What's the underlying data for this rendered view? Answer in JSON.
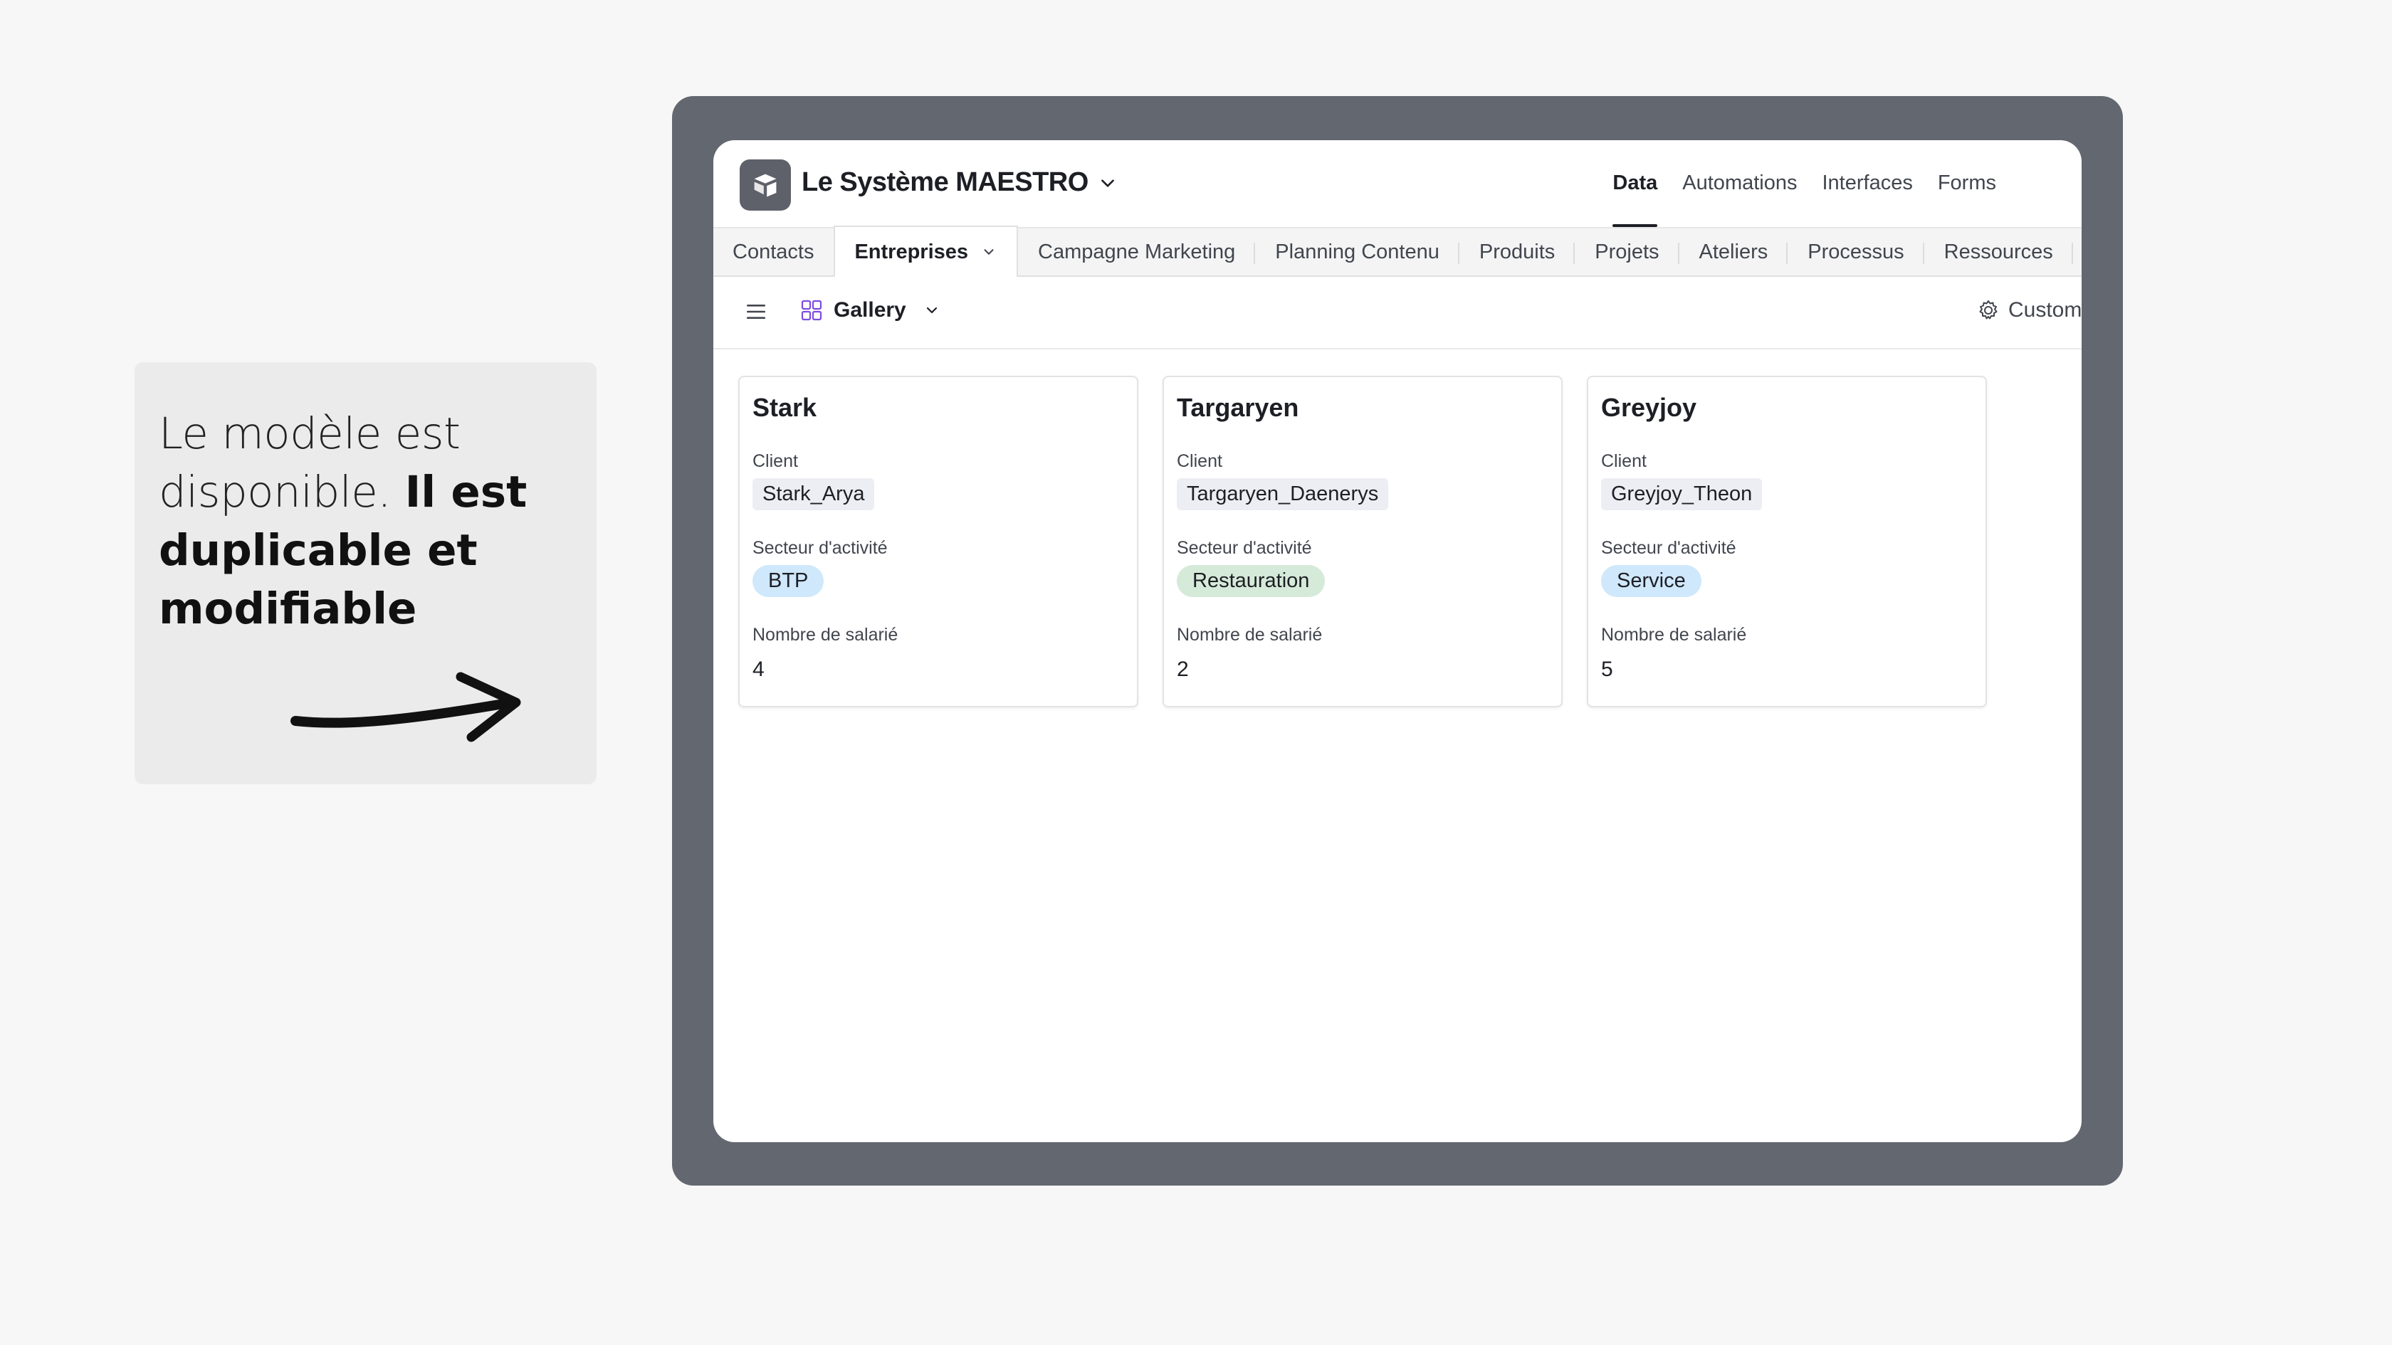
{
  "callout": {
    "text_light": "Le modèle est disponible.",
    "text_bold": "Il est duplicable et modifiable"
  },
  "app": {
    "base_name": "Le Système MAESTRO",
    "top_nav": [
      {
        "label": "Data",
        "active": true
      },
      {
        "label": "Automations",
        "active": false
      },
      {
        "label": "Interfaces",
        "active": false
      },
      {
        "label": "Forms",
        "active": false
      }
    ],
    "tables": [
      {
        "label": "Contacts",
        "active": false
      },
      {
        "label": "Entreprises",
        "active": true
      },
      {
        "label": "Campagne Marketing",
        "active": false
      },
      {
        "label": "Planning Contenu",
        "active": false
      },
      {
        "label": "Produits",
        "active": false
      },
      {
        "label": "Projets",
        "active": false
      },
      {
        "label": "Ateliers",
        "active": false
      },
      {
        "label": "Processus",
        "active": false
      },
      {
        "label": "Ressources",
        "active": false
      }
    ],
    "view": {
      "name": "Gallery",
      "customize_label": "Custom"
    },
    "fields": {
      "client": "Client",
      "secteur": "Secteur d'activité",
      "nombre": "Nombre de salarié"
    },
    "cards": [
      {
        "title": "Stark",
        "client": "Stark_Arya",
        "secteur": "BTP",
        "secteur_color": "#cfe8fb",
        "nombre": "4"
      },
      {
        "title": "Targaryen",
        "client": "Targaryen_Daenerys",
        "secteur": "Restauration",
        "secteur_color": "#d6ead9",
        "nombre": "2"
      },
      {
        "title": "Greyjoy",
        "client": "Greyjoy_Theon",
        "secteur": "Service",
        "secteur_color": "#cfe8fb",
        "nombre": "5"
      }
    ]
  },
  "colors": {
    "frame": "#636770",
    "page_background": "#f7f7f7",
    "callout_background": "#ebebeb"
  }
}
